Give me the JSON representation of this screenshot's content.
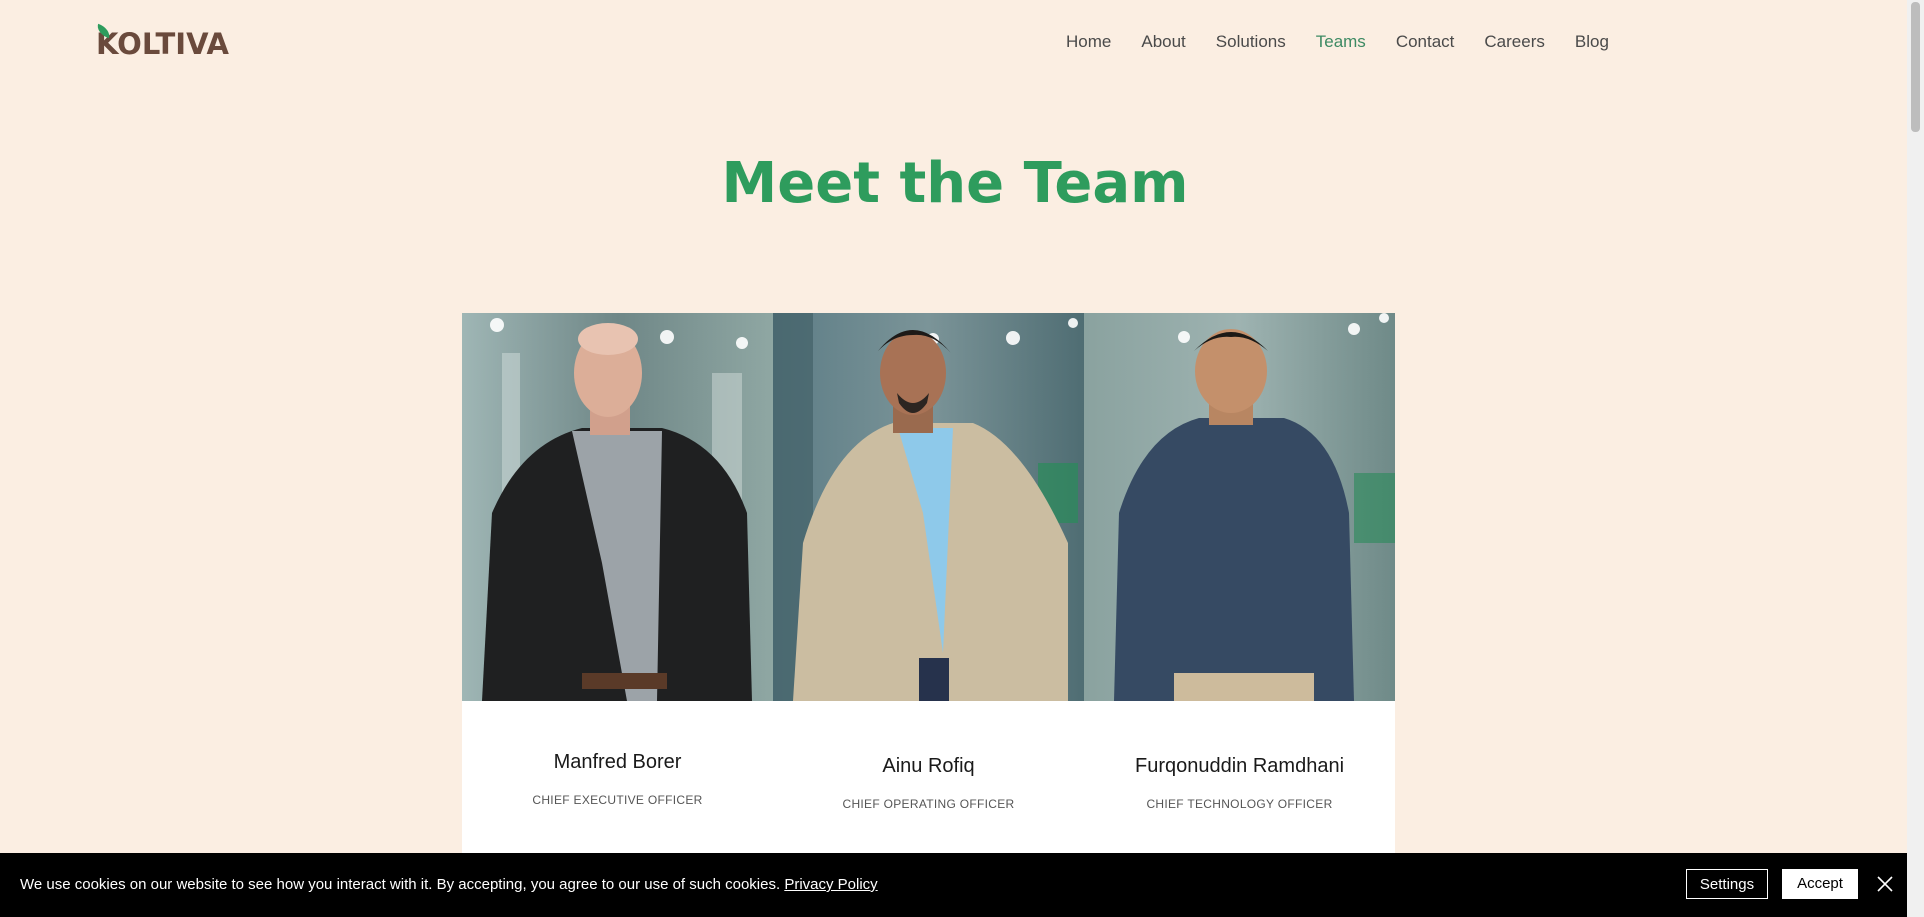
{
  "header": {
    "logo_text": "KOLTIVA",
    "nav": [
      {
        "label": "Home",
        "active": false
      },
      {
        "label": "About",
        "active": false
      },
      {
        "label": "Solutions",
        "active": false
      },
      {
        "label": "Teams",
        "active": true
      },
      {
        "label": "Contact",
        "active": false
      },
      {
        "label": "Careers",
        "active": false
      },
      {
        "label": "Blog",
        "active": false
      }
    ]
  },
  "main": {
    "title": "Meet the Team",
    "team": [
      {
        "name": "Manfred Borer",
        "role": "CHIEF EXECUTIVE OFFICER"
      },
      {
        "name": "Ainu Rofiq",
        "role": "CHIEF OPERATING OFFICER"
      },
      {
        "name": "Furqonuddin Ramdhani",
        "role": "CHIEF TECHNOLOGY OFFICER"
      }
    ]
  },
  "cookie_banner": {
    "message": "We use cookies on our website to see how you interact with it. By accepting, you agree to our use of such cookies.",
    "policy_link": "Privacy Policy",
    "settings_label": "Settings",
    "accept_label": "Accept"
  },
  "colors": {
    "background": "#fbeee2",
    "brand_green": "#2e9c5d",
    "logo_brown": "#6a4a3c",
    "active_nav": "#3d8a63"
  }
}
